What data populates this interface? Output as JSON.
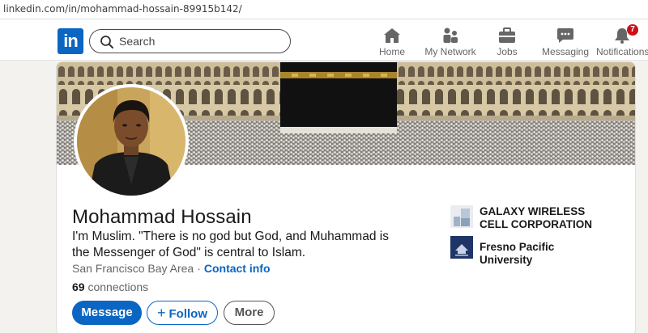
{
  "browser": {
    "url": "linkedin.com/in/mohammad-hossain-89915b142/"
  },
  "nav": {
    "logo_text": "in",
    "search_placeholder": "Search",
    "items": [
      {
        "label": "Home",
        "icon": "home-icon"
      },
      {
        "label": "My Network",
        "icon": "network-icon"
      },
      {
        "label": "Jobs",
        "icon": "briefcase-icon"
      },
      {
        "label": "Messaging",
        "icon": "messaging-icon"
      },
      {
        "label": "Notifications",
        "icon": "bell-icon",
        "badge": "7"
      }
    ]
  },
  "profile": {
    "name": "Mohammad Hossain",
    "headline": "I'm Muslim. \"There is no god but God, and Muhammad is the Messenger of God\" is central to Islam.",
    "location": "San Francisco Bay Area",
    "contact_info": "Contact info",
    "connections_count": "69",
    "connections_label": "connections",
    "actions": {
      "message": "Message",
      "follow": "Follow",
      "more": "More"
    },
    "organizations": [
      {
        "name": "GALAXY WIRELESS CELL CORPORATION",
        "icon": "company-logo"
      },
      {
        "name": "Fresno Pacific University",
        "icon": "university-logo"
      }
    ]
  },
  "colors": {
    "brand": "#0a66c2",
    "badge": "#cc1016"
  }
}
